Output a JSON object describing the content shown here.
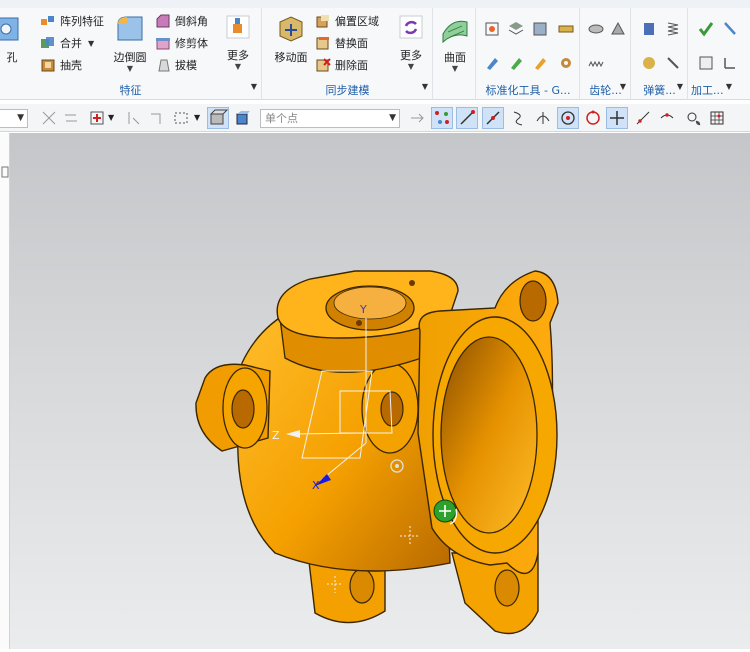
{
  "ribbon": {
    "groups": {
      "feature": {
        "label": "特征",
        "hole": "孔",
        "pattern": "阵列特征",
        "unite": "合并",
        "shell": "抽壳",
        "edge_blend": "边倒圆",
        "chamfer": "倒斜角",
        "trim_body": "修剪体",
        "draft": "拔模",
        "more": "更多"
      },
      "sync": {
        "label": "同步建模",
        "move_face": "移动面",
        "offset_region": "偏置区域",
        "replace_face": "替换面",
        "delete_face": "删除面",
        "more": "更多"
      },
      "surface": {
        "label": "曲面"
      },
      "standard": {
        "label": "标准化工具 - G..."
      },
      "gear": {
        "label": "齿轮..."
      },
      "spring": {
        "label": "弹簧..."
      },
      "machining": {
        "label": "加工..."
      }
    }
  },
  "toolbar": {
    "point_combo_placeholder": "单个点"
  },
  "viewport": {
    "axes": {
      "x": "X",
      "y": "Y",
      "z": "Z"
    }
  },
  "colors": {
    "model_orange": "#f5a000",
    "model_shadow": "#b86a00",
    "accent_blue": "#1f5fa8",
    "ribbon_bg": "#f7f8fa"
  }
}
